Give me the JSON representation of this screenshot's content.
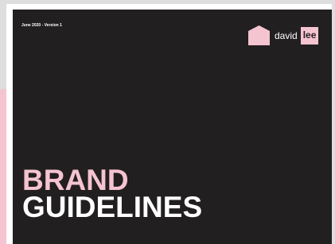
{
  "cover": {
    "date_version": "June 2020 - Version 1",
    "title_line1": "BRAND",
    "title_line2": "GUIDELINES"
  },
  "logo": {
    "icon": "house-icon",
    "first_name": "david",
    "last_name": "lee"
  },
  "colors": {
    "background": "#221f20",
    "accent_pink": "#f5c4d1",
    "text_white": "#ffffff",
    "frame_grey": "#dedede"
  }
}
